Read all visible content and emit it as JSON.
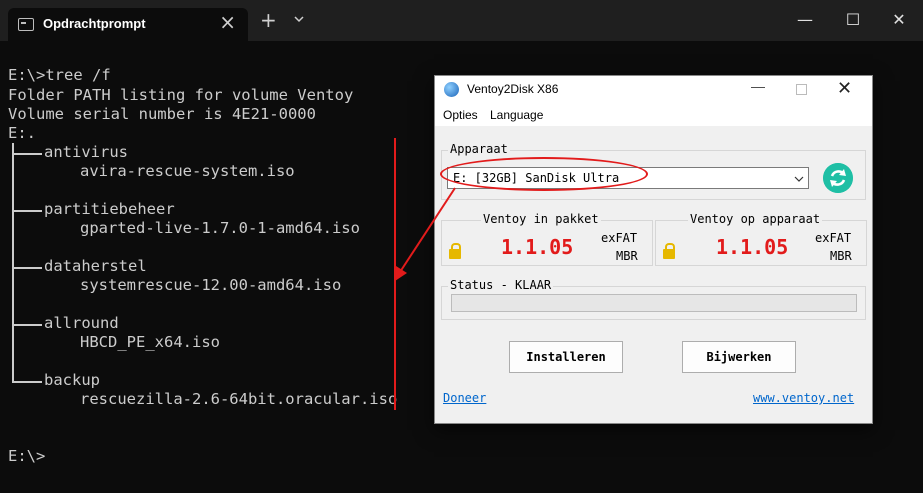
{
  "terminal": {
    "tab_title": "Opdrachtprompt",
    "new_tab": "+",
    "lines": [
      "E:\\>tree /f",
      "Folder PATH listing for volume Ventoy",
      "Volume serial number is 4E21-0000",
      "E:."
    ],
    "tree": [
      {
        "folder": "antivirus",
        "file": "avira-rescue-system.iso"
      },
      {
        "folder": "partitiebeheer",
        "file": "gparted-live-1.7.0-1-amd64.iso"
      },
      {
        "folder": "dataherstel",
        "file": "systemrescue-12.00-amd64.iso"
      },
      {
        "folder": "allround",
        "file": "HBCD_PE_x64.iso"
      },
      {
        "folder": "backup",
        "file": "rescuezilla-2.6-64bit.oracular.iso"
      }
    ],
    "prompt": "E:\\>"
  },
  "window_buttons": {
    "minimize": "—",
    "maximize": "☐",
    "close": "✕"
  },
  "ventoy": {
    "title": "Ventoy2Disk  X86",
    "menu": [
      "Opties",
      "Language"
    ],
    "device_group": "Apparaat",
    "device": "E: [32GB] SanDisk Ultra",
    "package_group": "Ventoy in pakket",
    "package_version": "1.1.05",
    "package_fs": "exFAT",
    "package_style": "MBR",
    "device_ver_group": "Ventoy op apparaat",
    "device_version": "1.1.05",
    "device_fs": "exFAT",
    "device_style": "MBR",
    "status": "Status - KLAAR",
    "progress": 0,
    "install_btn": "Installeren",
    "update_btn": "Bijwerken",
    "donate_link": "Doneer",
    "site_link": "www.ventoy.net"
  },
  "colors": {
    "annotation": "#e21b1b",
    "version": "#e21b1b",
    "refresh": "#1fbfa5"
  }
}
